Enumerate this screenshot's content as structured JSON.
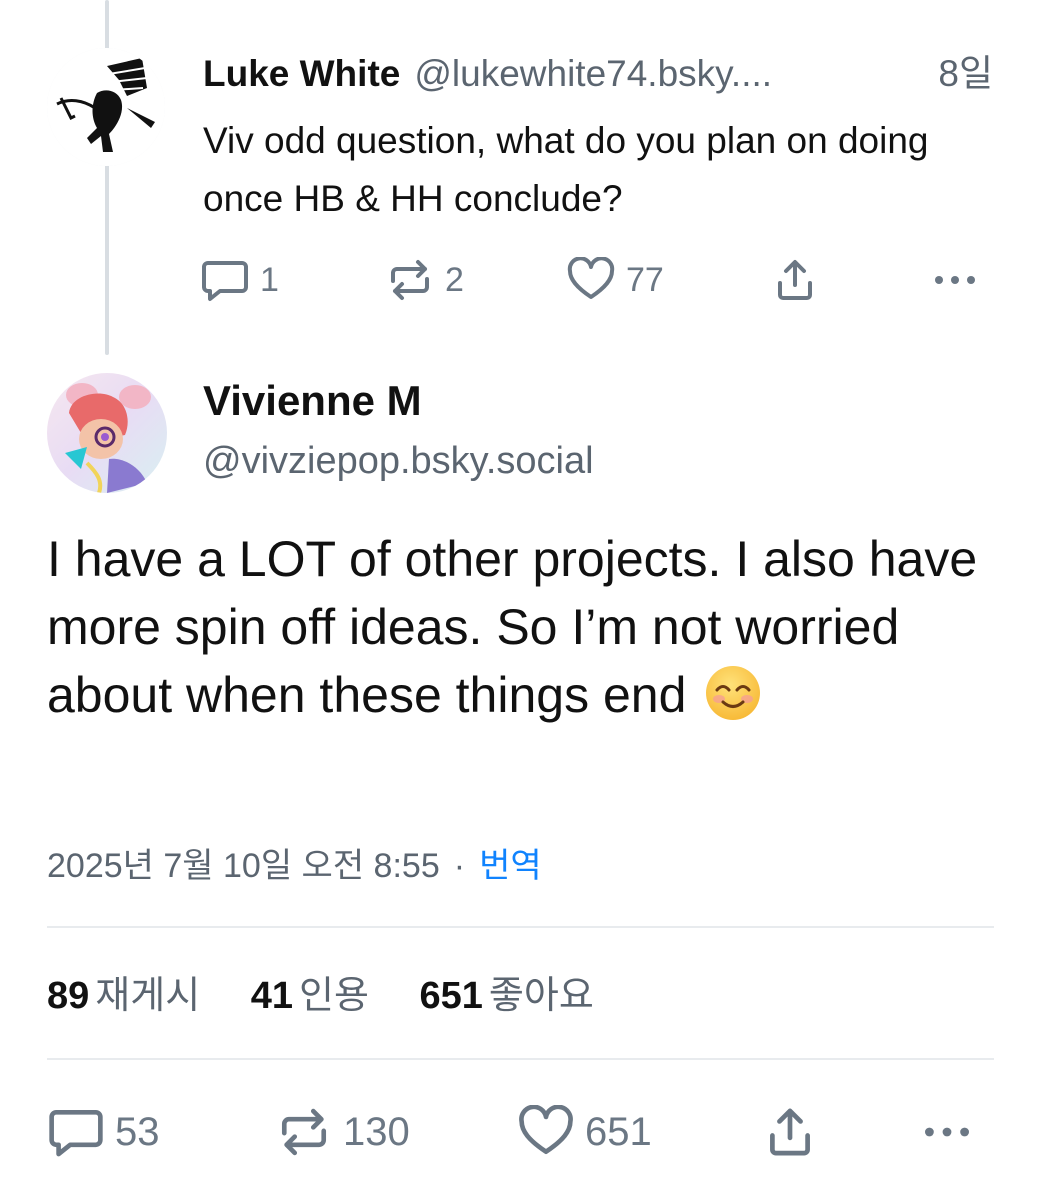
{
  "parent_post": {
    "author_name": "Luke White",
    "handle": "@lukewhite74.bsky....",
    "time": "8일",
    "text": "Viv odd question, what do you plan on doing once HB & HH conclude?",
    "actions": {
      "reply_count": "1",
      "repost_count": "2",
      "like_count": "77"
    }
  },
  "main_post": {
    "author_name": "Vivienne M",
    "handle": "@vivziepop.bsky.social",
    "text": "I have a LOT of other projects. I also have more spin off ideas. So I’m not worried about when these things end",
    "emoji": "😊",
    "timestamp": "2025년 7월 10일 오전 8:55",
    "separator": "·",
    "translate_label": "번역",
    "stats": {
      "reposts_num": "89",
      "reposts_label": "재게시",
      "quotes_num": "41",
      "quotes_label": "인용",
      "likes_num": "651",
      "likes_label": "좋아요"
    },
    "actions": {
      "reply_count": "53",
      "repost_count": "130",
      "like_count": "651"
    }
  },
  "colors": {
    "text": "#0f1419",
    "secondary": "#5b6570",
    "link": "#1083fe",
    "icon": "#6b7784",
    "divider": "#e8ebee"
  },
  "icons": [
    "comment-icon",
    "repost-icon",
    "heart-icon",
    "share-icon",
    "more-icon"
  ]
}
